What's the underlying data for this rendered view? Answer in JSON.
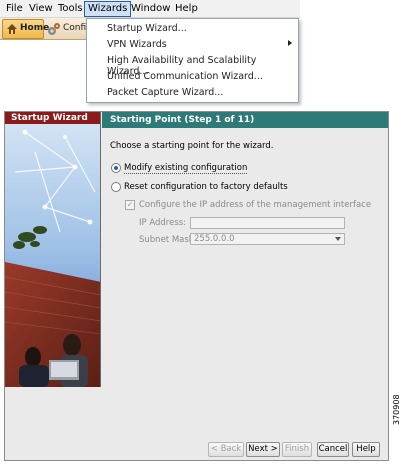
{
  "menubar": {
    "items": [
      "File",
      "View",
      "Tools",
      "Wizards",
      "Window",
      "Help"
    ]
  },
  "toolbar": {
    "home_label": "Home",
    "config_label": "Config"
  },
  "wizards_menu": {
    "items": [
      "Startup Wizard...",
      "VPN Wizards",
      "High Availability and Scalability Wizard...",
      "Unified Communication Wizard...",
      "Packet Capture Wizard..."
    ],
    "submenu_item": "VPN Wizards"
  },
  "wizard": {
    "left_title": "Startup Wizard",
    "header": "Starting Point  (Step 1 of 11)",
    "prompt": "Choose a starting point for the wizard.",
    "options": [
      {
        "label": "Modify existing configuration",
        "selected": true
      },
      {
        "label": "Reset configuration to factory defaults",
        "selected": false
      }
    ],
    "configure_ip": {
      "label": "Configure the IP address of the management interface",
      "checked": true,
      "enabled": false
    },
    "ip_address": {
      "label": "IP Address:",
      "value": ""
    },
    "subnet_mask": {
      "label": "Subnet Mask:",
      "value": "255.0.0.0"
    },
    "buttons": {
      "back": "< Back",
      "next": "Next >",
      "finish": "Finish",
      "cancel": "Cancel",
      "help": "Help"
    }
  },
  "figure_id": "370908",
  "colors": {
    "left_title_bg": "#8b1a1a",
    "header_bg": "#2e7a78",
    "menu_active_bg": "#cfe1f6"
  }
}
